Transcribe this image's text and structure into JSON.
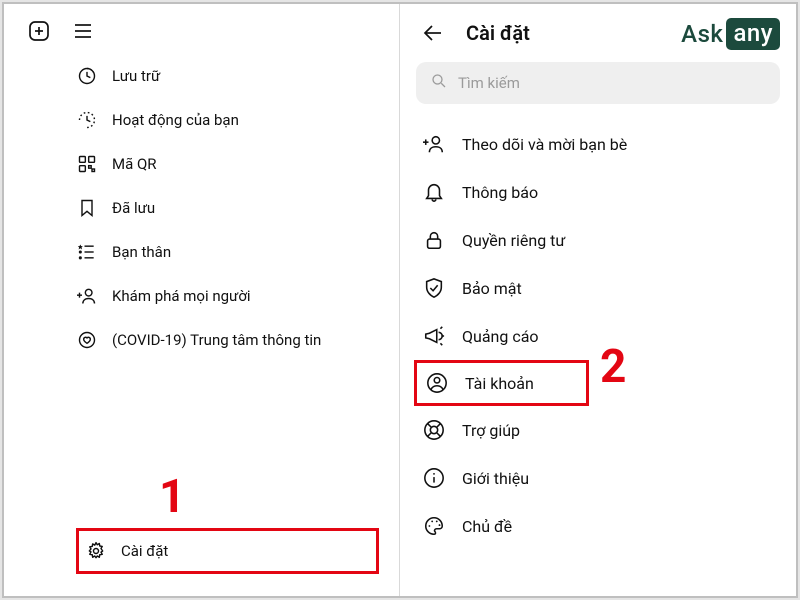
{
  "left": {
    "menu": [
      {
        "label": "Lưu trữ"
      },
      {
        "label": "Hoạt động của bạn"
      },
      {
        "label": "Mã QR"
      },
      {
        "label": "Đã lưu"
      },
      {
        "label": "Bạn thân"
      },
      {
        "label": "Khám phá mọi người"
      },
      {
        "label": "(COVID-19) Trung tâm thông tin"
      }
    ],
    "settings_label": "Cài đặt",
    "callout": "1"
  },
  "right": {
    "title": "Cài đặt",
    "search_placeholder": "Tìm kiếm",
    "items": [
      {
        "label": "Theo dõi và mời bạn bè"
      },
      {
        "label": "Thông báo"
      },
      {
        "label": "Quyền riêng tư"
      },
      {
        "label": "Bảo mật"
      },
      {
        "label": "Quảng cáo"
      },
      {
        "label": "Tài khoản"
      },
      {
        "label": "Trợ giúp"
      },
      {
        "label": "Giới thiệu"
      },
      {
        "label": "Chủ đề"
      }
    ],
    "callout": "2"
  },
  "brand": {
    "ask": "Ask",
    "any": "any"
  }
}
